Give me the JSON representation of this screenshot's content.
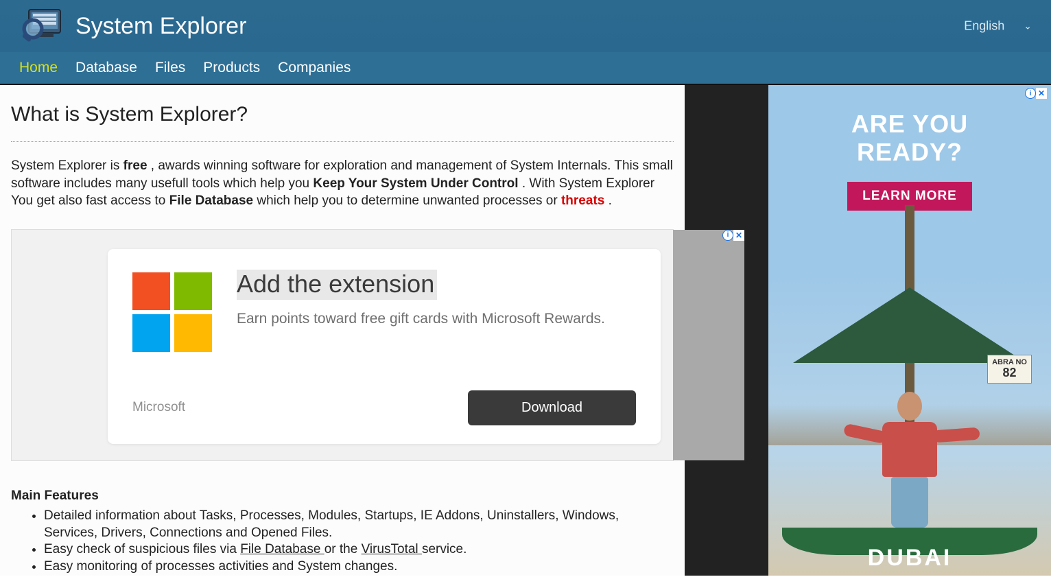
{
  "header": {
    "site_title": "System Explorer",
    "language": "English"
  },
  "nav": [
    {
      "label": "Home",
      "active": true
    },
    {
      "label": "Database",
      "active": false
    },
    {
      "label": "Files",
      "active": false
    },
    {
      "label": "Products",
      "active": false
    },
    {
      "label": "Companies",
      "active": false
    }
  ],
  "main": {
    "heading": "What is System Explorer?",
    "intro": {
      "pre": "System Explorer is ",
      "free": "free",
      "mid1": " , awards winning software for exploration and management of System Internals. This small software includes many usefull tools which help you ",
      "keep": "Keep Your System Under Control",
      "mid2": " . With System Explorer You get also fast access to ",
      "filedb": "File Database",
      "mid3": " which help you to determine unwanted processes or ",
      "threats": "threats",
      "end": " ."
    },
    "inline_ad": {
      "headline": "Add the extension",
      "subline": "Earn points toward free gift cards with Microsoft Rewards.",
      "brand": "Microsoft",
      "cta": "Download"
    },
    "features_heading": "Main Features",
    "features": [
      {
        "text": "Detailed information about Tasks, Processes, Modules, Startups, IE Addons, Uninstallers, Windows, Services, Drivers, Connections and Opened Files."
      },
      {
        "text_pre": "Easy check of suspicious files via ",
        "link1": "File Database ",
        "text_mid": "or the ",
        "link2": "VirusTotal ",
        "text_post": "service."
      },
      {
        "text": "Easy monitoring of processes activities and System changes."
      }
    ]
  },
  "right_ad": {
    "line1": "ARE YOU",
    "line2": "READY?",
    "cta": "LEARN MORE",
    "sign_top": "ABRA NO",
    "sign_num": "82",
    "brand": "DUBAI"
  }
}
